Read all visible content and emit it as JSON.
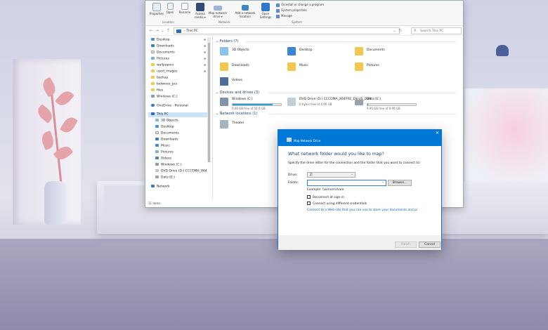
{
  "ribbon": {
    "buttons": [
      {
        "label": "Properties",
        "icon": "properties-icon"
      },
      {
        "label": "Open",
        "icon": "open-icon"
      },
      {
        "label": "Rename",
        "icon": "rename-icon"
      },
      {
        "label": "Access media ▾",
        "icon": "access-media-icon"
      },
      {
        "label": "Map network drive ▾",
        "icon": "map-drive-icon"
      },
      {
        "label": "Add a network location",
        "icon": "add-location-icon"
      },
      {
        "label": "Open Settings",
        "icon": "settings-icon"
      }
    ],
    "system_links": [
      "Uninstall or change a program",
      "System properties",
      "Manage"
    ],
    "groups": {
      "location": "Location",
      "network": "Network",
      "system": "System"
    }
  },
  "address": {
    "path": "› This PC",
    "search_placeholder": "Search This PC"
  },
  "nav": {
    "items": [
      {
        "label": "Desktop",
        "pinned": true
      },
      {
        "label": "Downloads",
        "pinned": true
      },
      {
        "label": "Documents",
        "pinned": true
      },
      {
        "label": "Pictures",
        "pinned": true
      },
      {
        "label": "wallpapers",
        "pinned": true
      },
      {
        "label": "used_images",
        "pinned": true
      },
      {
        "label": "backup",
        "pinned": false
      },
      {
        "label": "between_pcs",
        "pinned": false
      },
      {
        "label": "files",
        "pinned": false
      },
      {
        "label": "Windows (C:)",
        "pinned": false
      }
    ],
    "onedrive": "OneDrive - Personal",
    "thispc": "This PC",
    "thispc_items": [
      "3D Objects",
      "Desktop",
      "Documents",
      "Downloads",
      "Music",
      "Pictures",
      "Videos",
      "Windows (C:)",
      "DVD Drive (D:) CCCOMA_X64",
      "Data (E:)"
    ],
    "network": "Network"
  },
  "folders": {
    "heading": "Folders (7)",
    "items": [
      "3D Objects",
      "Desktop",
      "Documents",
      "Downloads",
      "Music",
      "Pictures",
      "Videos"
    ]
  },
  "drives": {
    "heading": "Devices and drives (3)",
    "items": [
      {
        "label": "Windows (C:)",
        "detail": "9.60 GB free of 54.9 GB",
        "used": 0.83
      },
      {
        "label": "DVD Drive (D:) CCCOMA_X64FRE_EN-US_DV9",
        "detail": "0 bytes free of 4.90 GB",
        "used": null
      },
      {
        "label": "Data (E:)",
        "detail": "9.95 GB free of 9.99 GB",
        "used": 0.01
      }
    ]
  },
  "network_locations": {
    "heading": "Network locations (1)",
    "items": [
      "Theater"
    ]
  },
  "status": "11 items",
  "dialog": {
    "caption": "Map Network Drive",
    "heading": "What network folder would you like to map?",
    "intro": "Specify the drive letter for the connection and the folder that you want to connect to:",
    "drive_label": "Drive:",
    "drive_value": "Z:",
    "folder_label": "Folder:",
    "folder_value": "",
    "browse": "Browse...",
    "example": "Example: \\\\server\\share",
    "reconnect": "Reconnect at sign-in",
    "different_creds": "Connect using different credentials",
    "link": "Connect to a Web site that you can use to store your documents and pi",
    "finish": "Finish",
    "cancel": "Cancel"
  },
  "colors": {
    "accent": "#0078d7",
    "folder": "#f4c84f",
    "drive_bar": "#26a0da"
  }
}
